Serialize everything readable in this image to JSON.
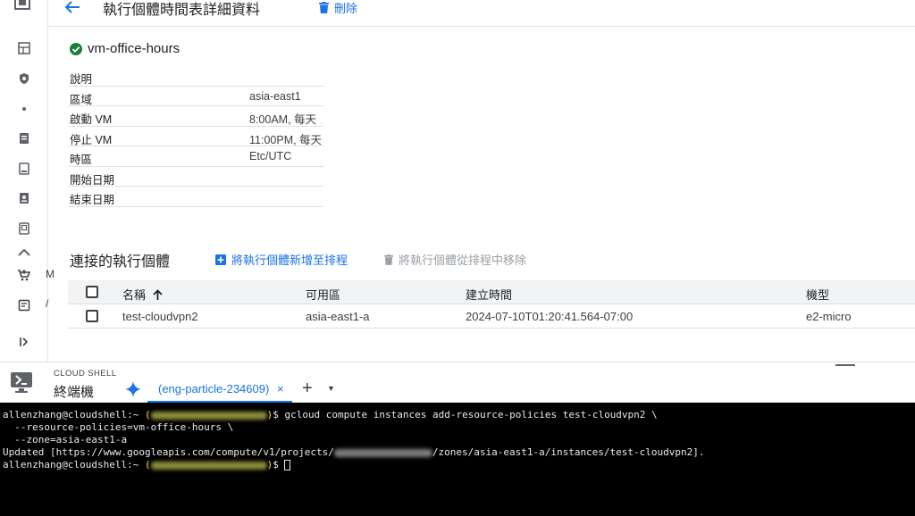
{
  "header": {
    "title": "執行個體時間表詳細資料",
    "delete_label": "刪除"
  },
  "schedule": {
    "name": "vm-office-hours",
    "status": "ok"
  },
  "details": [
    {
      "key": "說明",
      "value": ""
    },
    {
      "key": "區域",
      "value": "asia-east1"
    },
    {
      "key": "啟動 VM",
      "value": "8:00AM, 每天"
    },
    {
      "key": "停止 VM",
      "value": "11:00PM, 每天"
    },
    {
      "key": "時區",
      "value": "Etc/UTC"
    },
    {
      "key": "開始日期",
      "value": ""
    },
    {
      "key": "結束日期",
      "value": ""
    }
  ],
  "instances": {
    "title": "連接的執行個體",
    "add_label": "將執行個體新增至排程",
    "remove_label": "將執行個體從排程中移除",
    "columns": [
      "名稱",
      "可用區",
      "建立時間",
      "機型"
    ],
    "rows": [
      {
        "name": "test-cloudvpn2",
        "zone": "asia-east1-a",
        "created": "2024-07-10T01:20:41.564-07:00",
        "machine_type": "e2-micro"
      }
    ]
  },
  "cloud_shell": {
    "label": "CLOUD SHELL",
    "subtitle": "終端機",
    "tab_label": "(eng-particle-234609)",
    "tab_close": "×",
    "plus": "+",
    "more": "▼"
  },
  "terminal": {
    "prompt_user": "allenzhang@cloudshell:~ ",
    "command1": "$ gcloud compute instances add-resource-policies test-cloudvpn2 \\",
    "line2": "  --resource-policies=vm-office-hours \\",
    "line3": "  --zone=asia-east1-a",
    "line4_start": "Updated [https://www.googleapis.com/compute/v1/projects/",
    "line4_end": "/zones/asia-east1-a/instances/test-cloudvpn2].",
    "prompt_end": "$ "
  },
  "colors": {
    "accent": "#1a73e8",
    "success": "#188038",
    "terminal_bg": "#000000"
  }
}
